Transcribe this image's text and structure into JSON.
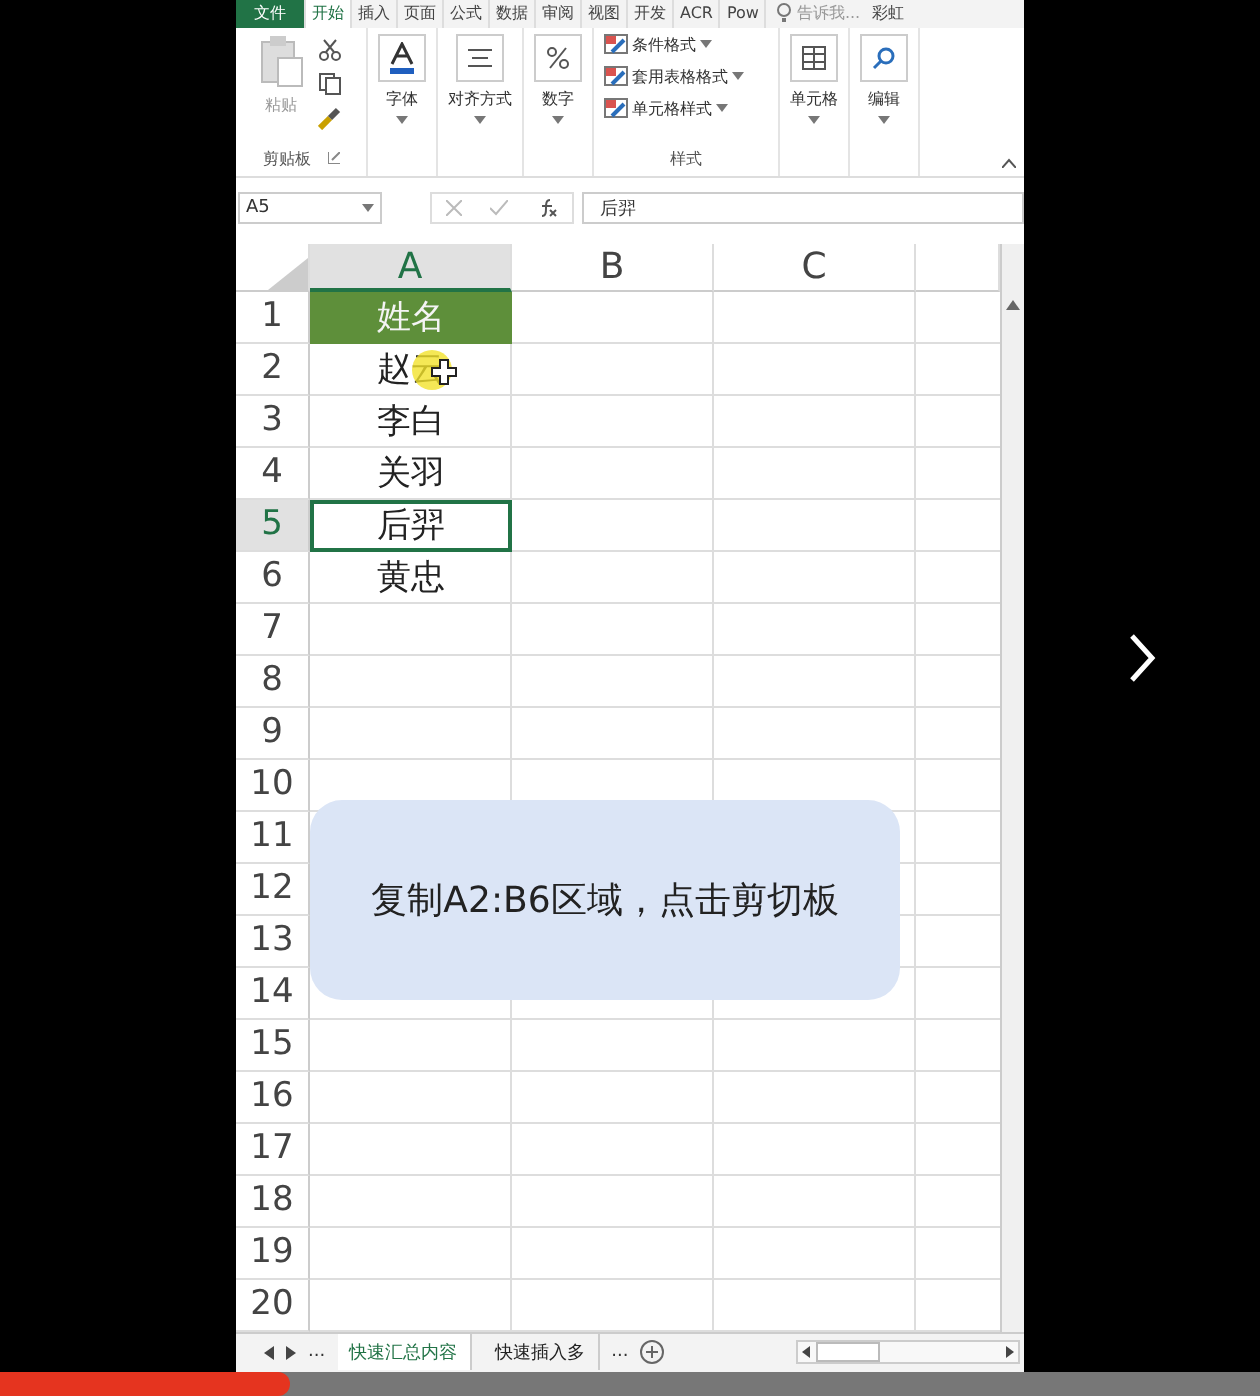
{
  "ribbon_tabs": [
    {
      "label": "文件",
      "kind": "file",
      "selected": false
    },
    {
      "label": "开始",
      "kind": "tab",
      "selected": true
    },
    {
      "label": "插入",
      "kind": "tab",
      "selected": false
    },
    {
      "label": "页面",
      "kind": "tab",
      "selected": false
    },
    {
      "label": "公式",
      "kind": "tab",
      "selected": false
    },
    {
      "label": "数据",
      "kind": "tab",
      "selected": false
    },
    {
      "label": "审阅",
      "kind": "tab",
      "selected": false
    },
    {
      "label": "视图",
      "kind": "tab",
      "selected": false
    },
    {
      "label": "开发",
      "kind": "tab",
      "selected": false
    },
    {
      "label": "ACR",
      "kind": "tab",
      "selected": false
    },
    {
      "label": "Pow",
      "kind": "tab",
      "selected": false
    }
  ],
  "tell_me": "告诉我...",
  "user": "彩虹",
  "clipboard": {
    "paste": "粘贴",
    "group": "剪贴板"
  },
  "big_buttons": [
    {
      "label": "字体",
      "kind": "font"
    },
    {
      "label": "对齐方式",
      "kind": "align"
    },
    {
      "label": "数字",
      "kind": "number"
    }
  ],
  "styles": {
    "items": [
      "条件格式",
      "套用表格格式",
      "单元格样式"
    ],
    "group": "样式"
  },
  "end_buttons": [
    {
      "label": "单元格",
      "kind": "cells"
    },
    {
      "label": "编辑",
      "kind": "edit"
    }
  ],
  "name_box": "A5",
  "formula": "后羿",
  "columns": [
    {
      "label": "A",
      "selected": true
    },
    {
      "label": "B",
      "selected": false
    },
    {
      "label": "C",
      "selected": false
    }
  ],
  "rows": [
    {
      "number": "1",
      "a": "姓名",
      "kind": "heading",
      "selected": false,
      "pointer": false
    },
    {
      "number": "2",
      "a": "赵云",
      "kind": "plain",
      "selected": false,
      "pointer": true
    },
    {
      "number": "3",
      "a": "李白",
      "kind": "plain",
      "selected": false,
      "pointer": false
    },
    {
      "number": "4",
      "a": "关羽",
      "kind": "plain",
      "selected": false,
      "pointer": false
    },
    {
      "number": "5",
      "a": "后羿",
      "kind": "plain",
      "selected": true,
      "pointer": false
    },
    {
      "number": "6",
      "a": "黄忠",
      "kind": "plain",
      "selected": false,
      "pointer": false
    },
    {
      "number": "7",
      "selected": false,
      "pointer": false
    },
    {
      "number": "8",
      "selected": false,
      "pointer": false
    },
    {
      "number": "9",
      "selected": false,
      "pointer": false
    },
    {
      "number": "10",
      "selected": false,
      "pointer": false
    },
    {
      "number": "11",
      "selected": false,
      "pointer": false
    },
    {
      "number": "12",
      "selected": false,
      "pointer": false
    },
    {
      "number": "13",
      "selected": false,
      "pointer": false
    },
    {
      "number": "14",
      "selected": false,
      "pointer": false
    },
    {
      "number": "15",
      "selected": false,
      "pointer": false
    },
    {
      "number": "16",
      "selected": false,
      "pointer": false
    },
    {
      "number": "17",
      "selected": false,
      "pointer": false
    },
    {
      "number": "18",
      "selected": false,
      "pointer": false
    },
    {
      "number": "19",
      "selected": false,
      "pointer": false
    },
    {
      "number": "20",
      "selected": false,
      "pointer": false
    }
  ],
  "callout": "复制A2:B6区域，点击剪切板",
  "sheet_tabs": {
    "more_left": "...",
    "tabs": [
      {
        "label": "快速汇总内容",
        "selected": true
      },
      {
        "label": "快速插入多",
        "selected": false
      }
    ],
    "more_right": "..."
  },
  "player": {
    "level": 0.23
  }
}
